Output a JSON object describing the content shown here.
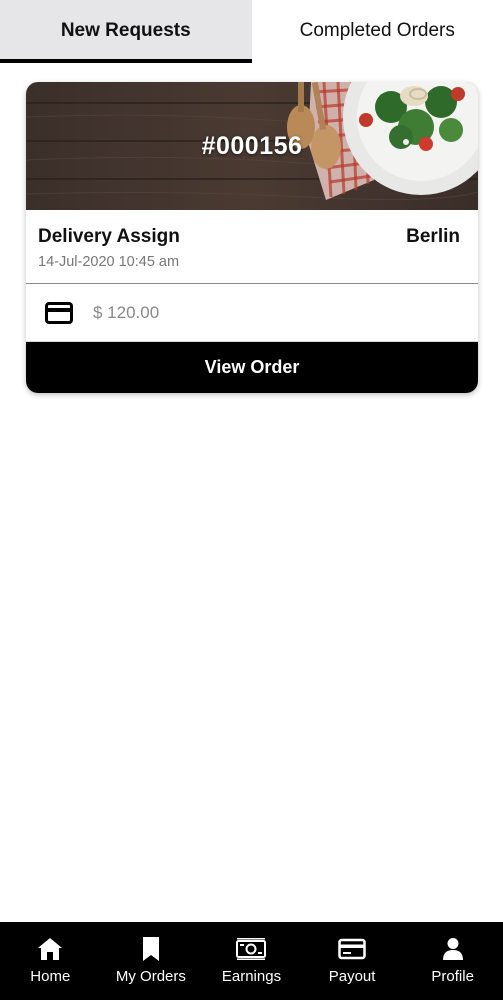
{
  "tabs": [
    {
      "label": "New Requests",
      "active": true
    },
    {
      "label": "Completed Orders",
      "active": false
    }
  ],
  "order": {
    "number": "#000156",
    "title": "Delivery Assign",
    "date": "14-Jul-2020 10:45 am",
    "city": "Berlin",
    "payment_icon": "credit-card-icon",
    "amount": "$ 120.00",
    "view_button": "View Order"
  },
  "bottom_nav": [
    {
      "label": "Home",
      "icon": "home-icon"
    },
    {
      "label": "My Orders",
      "icon": "bookmark-icon"
    },
    {
      "label": "Earnings",
      "icon": "banknote-icon"
    },
    {
      "label": "Payout",
      "icon": "credit-card-icon"
    },
    {
      "label": "Profile",
      "icon": "person-icon"
    }
  ],
  "colors": {
    "accent": "#000000",
    "active_tab_bg": "#e6e6e8",
    "muted_text": "#777777"
  }
}
